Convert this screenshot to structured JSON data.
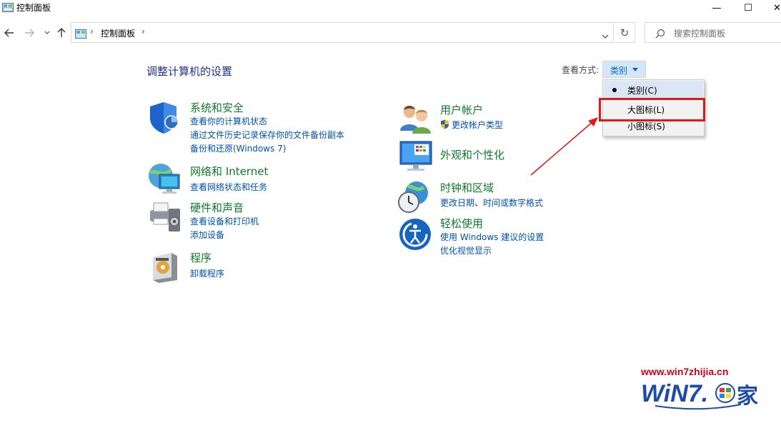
{
  "window": {
    "title": "控制面板",
    "minimize_glyph": "—",
    "maximize_glyph": "☐",
    "close_glyph": "✕"
  },
  "address_bar": {
    "path": "控制面板",
    "separator": "›",
    "refresh_glyph": "↻",
    "search_placeholder": "搜索控制面板"
  },
  "page": {
    "title": "调整计算机的设置",
    "view_by_label": "查看方式:",
    "view_by_value": "类别"
  },
  "view_menu": {
    "items": [
      {
        "label": "类别(C)",
        "selected": true
      },
      {
        "label": "大图标(L)",
        "selected": false,
        "highlighted": true
      },
      {
        "label": "小图标(S)",
        "selected": false
      }
    ]
  },
  "categories_left": [
    {
      "icon": "shield-icon",
      "title": "系统和安全",
      "links": [
        "查看你的计算机状态",
        "通过文件历史记录保存你的文件备份副本",
        "备份和还原(Windows 7)"
      ]
    },
    {
      "icon": "network-icon",
      "title": "网络和 Internet",
      "links": [
        "查看网络状态和任务"
      ]
    },
    {
      "icon": "printer-icon",
      "title": "硬件和声音",
      "links": [
        "查看设备和打印机",
        "添加设备"
      ]
    },
    {
      "icon": "programs-icon",
      "title": "程序",
      "links": [
        "卸载程序"
      ]
    }
  ],
  "categories_right": [
    {
      "icon": "users-icon",
      "title": "用户帐户",
      "links": [
        "更改帐户类型"
      ]
    },
    {
      "icon": "appearance-icon",
      "title": "外观和个性化",
      "links": []
    },
    {
      "icon": "clock-globe-icon",
      "title": "时钟和区域",
      "links": [
        "更改日期、时间或数字格式"
      ]
    },
    {
      "icon": "ease-of-access-icon",
      "title": "轻松使用",
      "links": [
        "使用 Windows 建议的设置",
        "优化视觉显示"
      ]
    }
  ],
  "watermark": {
    "url": "www.win7zhijia.cn",
    "logo_text": "WiN7.之家"
  },
  "colors": {
    "category_title": "#0f7a2b",
    "link": "#0050b0",
    "highlight_box": "#e01818",
    "menu_selected_bg": "#dbe6f4"
  }
}
